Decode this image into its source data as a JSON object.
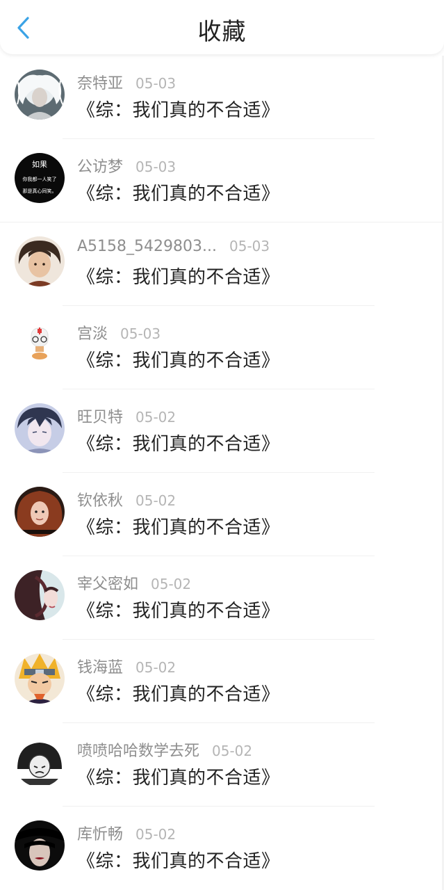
{
  "header": {
    "title": "收藏",
    "back_icon": "chevron-left-icon",
    "accent": "#3ba3e6"
  },
  "items": [
    {
      "name": "奈特亚",
      "date": "05-03",
      "book": "《综：我们真的不合适》"
    },
    {
      "name": "公访梦",
      "date": "05-03",
      "book": "《综：我们真的不合适》"
    },
    {
      "name": "A5158_5429803...",
      "date": "05-03",
      "book": "《综：我们真的不合适》"
    },
    {
      "name": "宫淡",
      "date": "05-03",
      "book": "《综：我们真的不合适》"
    },
    {
      "name": "旺贝特",
      "date": "05-02",
      "book": "《综：我们真的不合适》"
    },
    {
      "name": "钦依秋",
      "date": "05-02",
      "book": "《综：我们真的不合适》"
    },
    {
      "name": "宰父密如",
      "date": "05-02",
      "book": "《综：我们真的不合适》"
    },
    {
      "name": "钱海蓝",
      "date": "05-02",
      "book": "《综：我们真的不合适》"
    },
    {
      "name": "喷喷哈哈数学去死",
      "date": "05-02",
      "book": "《综：我们真的不合适》"
    },
    {
      "name": "库忻畅",
      "date": "05-02",
      "book": "《综：我们真的不合适》"
    }
  ],
  "avatar_texts": {
    "gongfangmeng": [
      "如果",
      "你我都一人笑了",
      "那是真心同笑。"
    ]
  }
}
